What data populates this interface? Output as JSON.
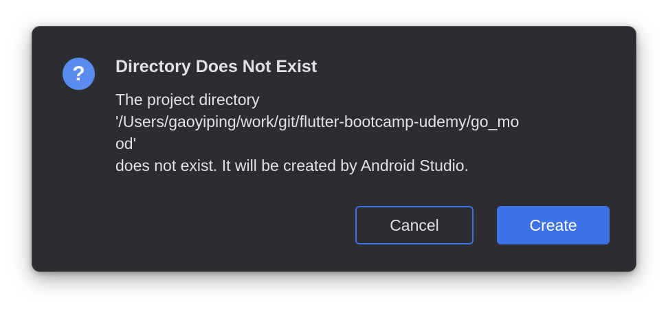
{
  "dialog": {
    "icon": "question-icon",
    "icon_glyph": "?",
    "title": "Directory Does Not Exist",
    "message_lines": [
      "The project directory",
      "'/Users/gaoyiping/work/git/flutter-bootcamp-udemy/go_mo",
      "od'",
      "does not exist. It will be created by Android Studio."
    ],
    "buttons": {
      "cancel_label": "Cancel",
      "create_label": "Create"
    }
  },
  "colors": {
    "dialog_background": "#2b2d30",
    "accent": "#3d73e6",
    "icon_background": "#5a8bf0",
    "text": "#dfe1e5"
  }
}
